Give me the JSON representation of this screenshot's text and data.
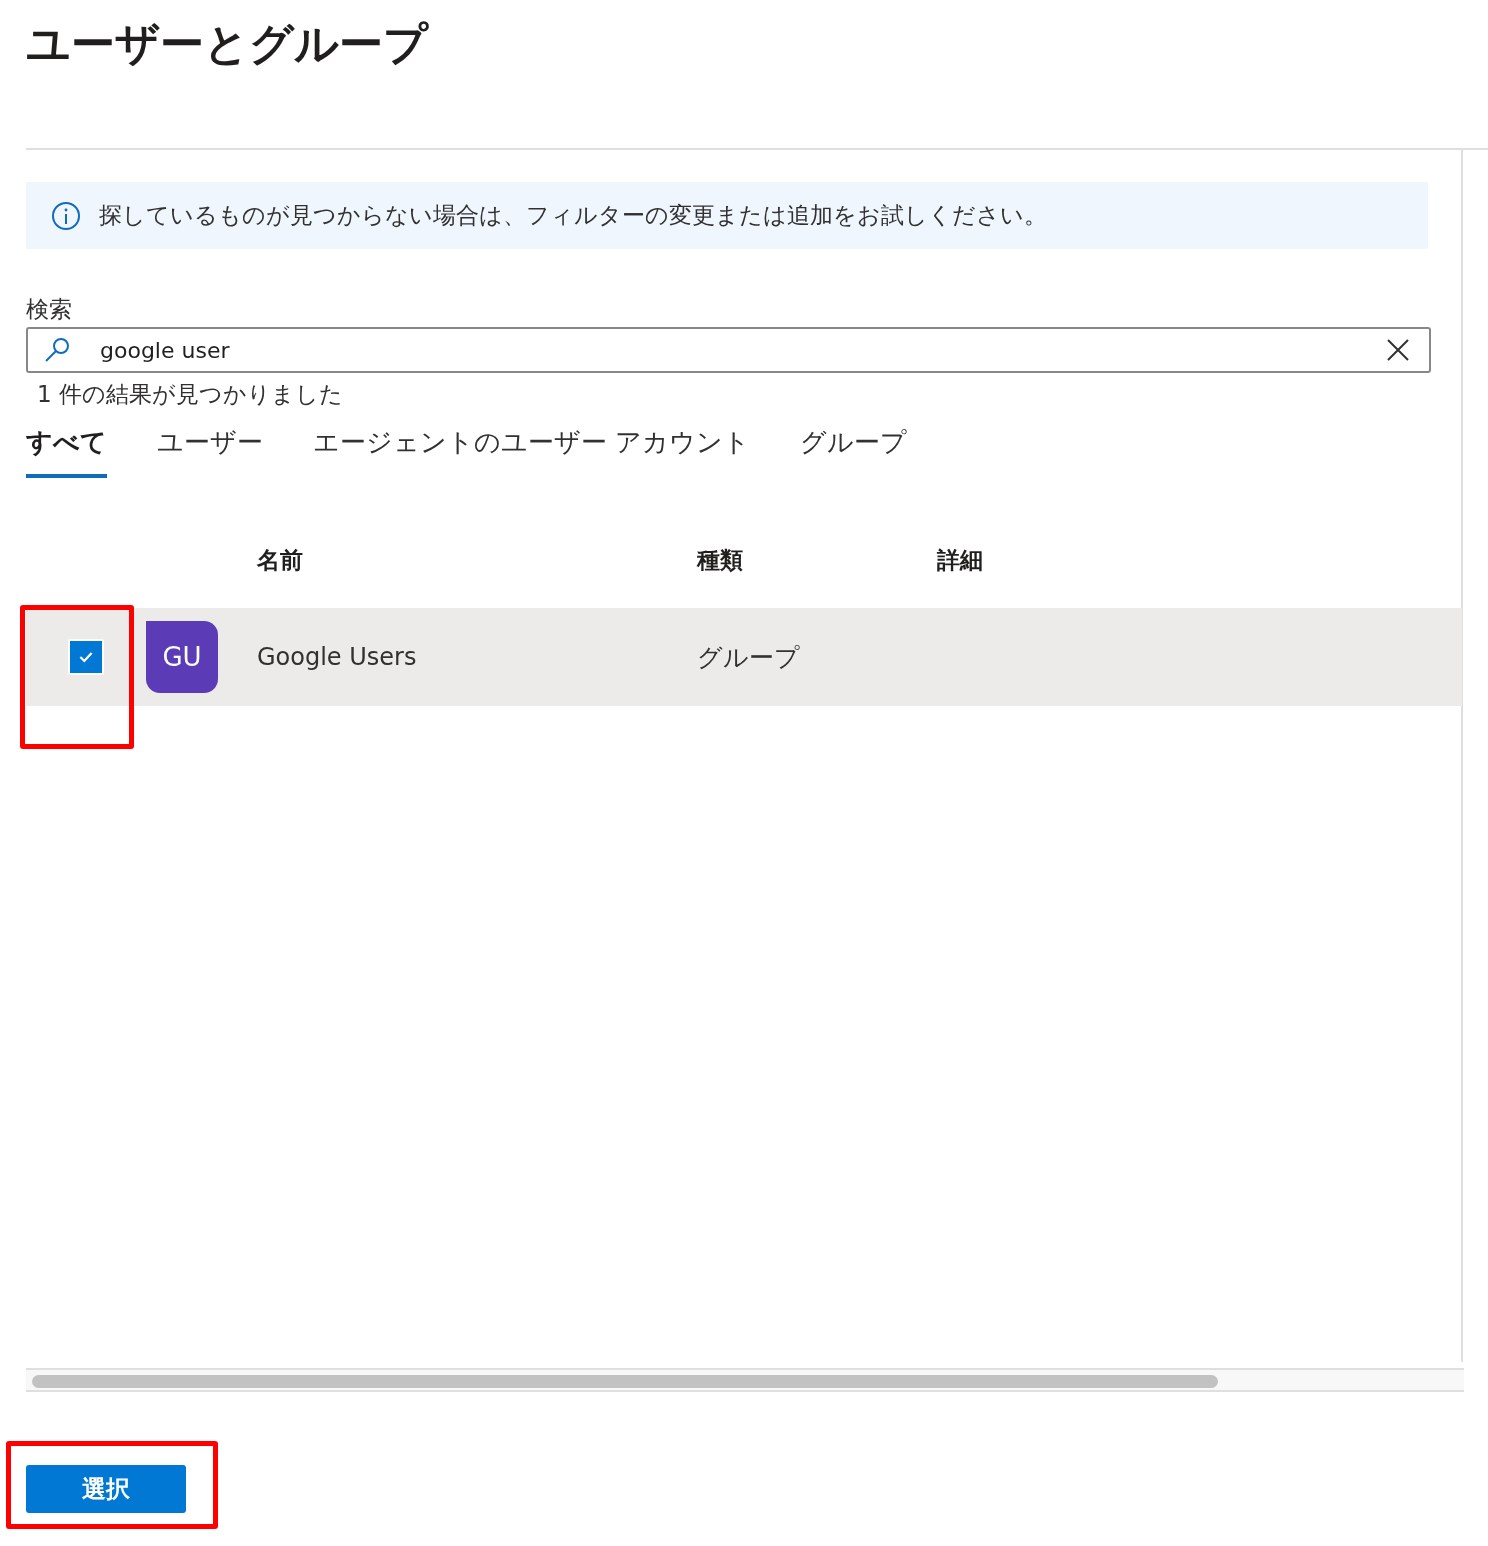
{
  "title": "ユーザーとグループ",
  "info": {
    "text": "探しているものが見つからない場合は、フィルターの変更または追加をお試しください。"
  },
  "search": {
    "label": "検索",
    "value": "google user"
  },
  "result_count": "1 件の結果が見つかりました",
  "tabs": [
    {
      "label": "すべて",
      "selected": true
    },
    {
      "label": "ユーザー",
      "selected": false
    },
    {
      "label": "エージェントのユーザー アカウント",
      "selected": false
    },
    {
      "label": "グループ",
      "selected": false
    }
  ],
  "table": {
    "columns": [
      "名前",
      "種類",
      "詳細"
    ],
    "rows": [
      {
        "checked": true,
        "selected": true,
        "initials": "GU",
        "color": "#5c3bb7",
        "name": "Google Users",
        "type": "グループ"
      }
    ]
  },
  "buttons": [
    {
      "label": "選択"
    }
  ]
}
